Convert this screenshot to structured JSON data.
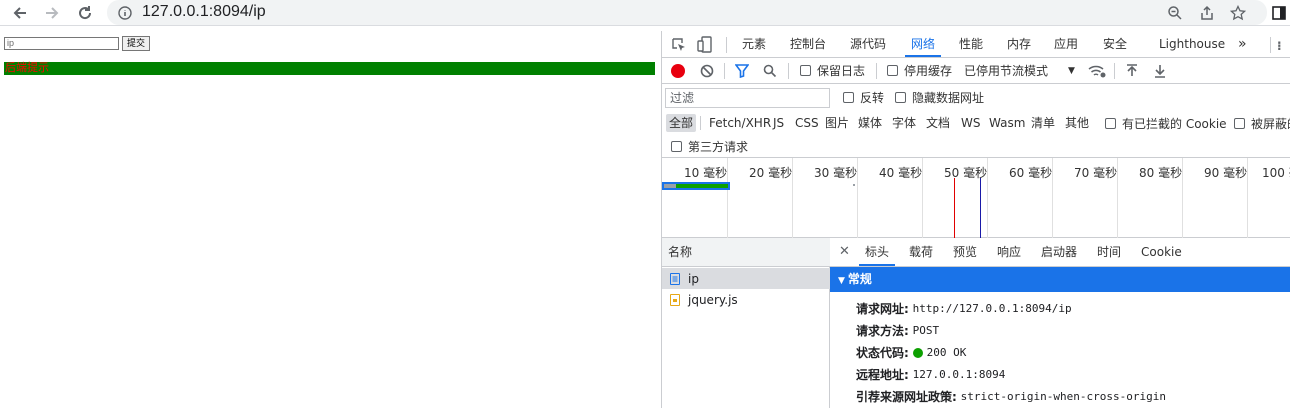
{
  "browser": {
    "url": "127.0.0.1:8094/ip"
  },
  "page": {
    "input_value": "ip",
    "submit_label": "提交",
    "status_text": "后端提示"
  },
  "devtools": {
    "tabs": [
      "元素",
      "控制台",
      "源代码",
      "网络",
      "性能",
      "内存",
      "应用",
      "安全",
      "Lighthouse"
    ],
    "more_tabs": "»",
    "toolbar": {
      "preserve_log": "保留日志",
      "disable_cache": "停用缓存",
      "throttle": "已停用节流模式"
    },
    "filter": {
      "placeholder": "过滤",
      "invert": "反转",
      "hide_data_urls": "隐藏数据网址"
    },
    "types": [
      "全部",
      "Fetch/XHR",
      "JS",
      "CSS",
      "图片",
      "媒体",
      "字体",
      "文档",
      "WS",
      "Wasm",
      "清单",
      "其他"
    ],
    "blocked_cookies": "有已拦截的 Cookie",
    "blocked_requests": "被屏蔽的",
    "third_party": "第三方请求",
    "timeline_ticks": [
      "10 毫秒",
      "20 毫秒",
      "30 毫秒",
      "40 毫秒",
      "50 毫秒",
      "60 毫秒",
      "70 毫秒",
      "80 毫秒",
      "90 毫秒",
      "100 毫"
    ],
    "name_header": "名称",
    "requests": [
      {
        "name": "ip"
      },
      {
        "name": "jquery.js"
      }
    ],
    "detail_tabs": [
      "标头",
      "载荷",
      "预览",
      "响应",
      "启动器",
      "时间",
      "Cookie"
    ],
    "section_title": "常规",
    "general": [
      {
        "key": "请求网址:",
        "value": "http://127.0.0.1:8094/ip"
      },
      {
        "key": "请求方法:",
        "value": "POST"
      },
      {
        "key": "状态代码:",
        "value": "200 OK"
      },
      {
        "key": "远程地址:",
        "value": "127.0.0.1:8094"
      },
      {
        "key": "引荐来源网址政策:",
        "value": "strict-origin-when-cross-origin"
      }
    ]
  },
  "colors": {
    "accent": "#1a73e8",
    "status_bg": "#008000",
    "status_text": "#ff0000",
    "record": "#e8000f",
    "ok_dot": "#0ca000"
  }
}
